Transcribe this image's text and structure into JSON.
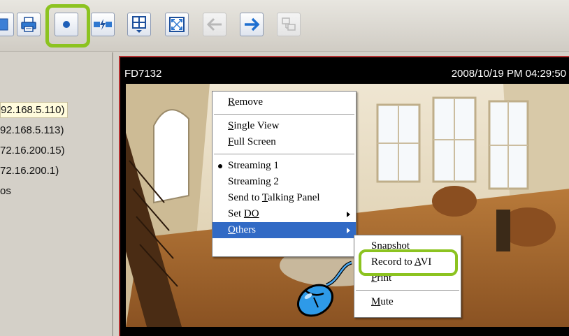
{
  "toolbar": {
    "buttons": [
      {
        "icon": "panel-icon",
        "enabled": true
      },
      {
        "icon": "printer-icon",
        "enabled": true
      },
      {
        "icon": "record-icon",
        "enabled": true,
        "highlighted": true
      },
      {
        "icon": "connect-icon",
        "enabled": true
      },
      {
        "icon": "layout-icon",
        "enabled": true
      },
      {
        "icon": "fullscreen-icon",
        "enabled": true
      },
      {
        "icon": "back-arrow-icon",
        "enabled": false
      },
      {
        "icon": "forward-arrow-icon",
        "enabled": true
      },
      {
        "icon": "network-icon",
        "enabled": false
      }
    ],
    "highlight_color": "#8cc320"
  },
  "device_list": {
    "items": [
      {
        "label": "92.168.5.110)",
        "selected": true
      },
      {
        "label": "92.168.5.113)"
      },
      {
        "label": "72.16.200.15)"
      },
      {
        "label": "72.16.200.1)"
      },
      {
        "label": "os"
      }
    ]
  },
  "video": {
    "camera_name": "FD7132",
    "timestamp": "2008/10/19 PM 04:29:50",
    "border_color": "#b43030"
  },
  "context_menu": {
    "remove": {
      "pre": "",
      "key": "R",
      "post": "emove"
    },
    "single_view": {
      "pre": "",
      "key": "S",
      "post": "ingle View"
    },
    "full_screen": {
      "pre": "",
      "key": "F",
      "post": "ull Screen"
    },
    "streaming_1": "Streaming 1",
    "streaming_2": "Streaming 2",
    "send_to_talking": {
      "pre": "Send to ",
      "key": "T",
      "post": "alking Panel"
    },
    "set_do": {
      "pre": "Set ",
      "key": "DO",
      "post": ""
    },
    "others": {
      "pre": "",
      "key": "O",
      "post": "thers"
    },
    "active_color": "#316ac5"
  },
  "submenu": {
    "snapshot": {
      "pre": "",
      "key": "S",
      "post": "napshot"
    },
    "record_to_avi": {
      "pre": "Record to ",
      "key": "A",
      "post": "VI"
    },
    "print": {
      "pre": "",
      "key": "P",
      "post": "rint"
    },
    "mute": {
      "pre": "",
      "key": "M",
      "post": "ute"
    }
  }
}
